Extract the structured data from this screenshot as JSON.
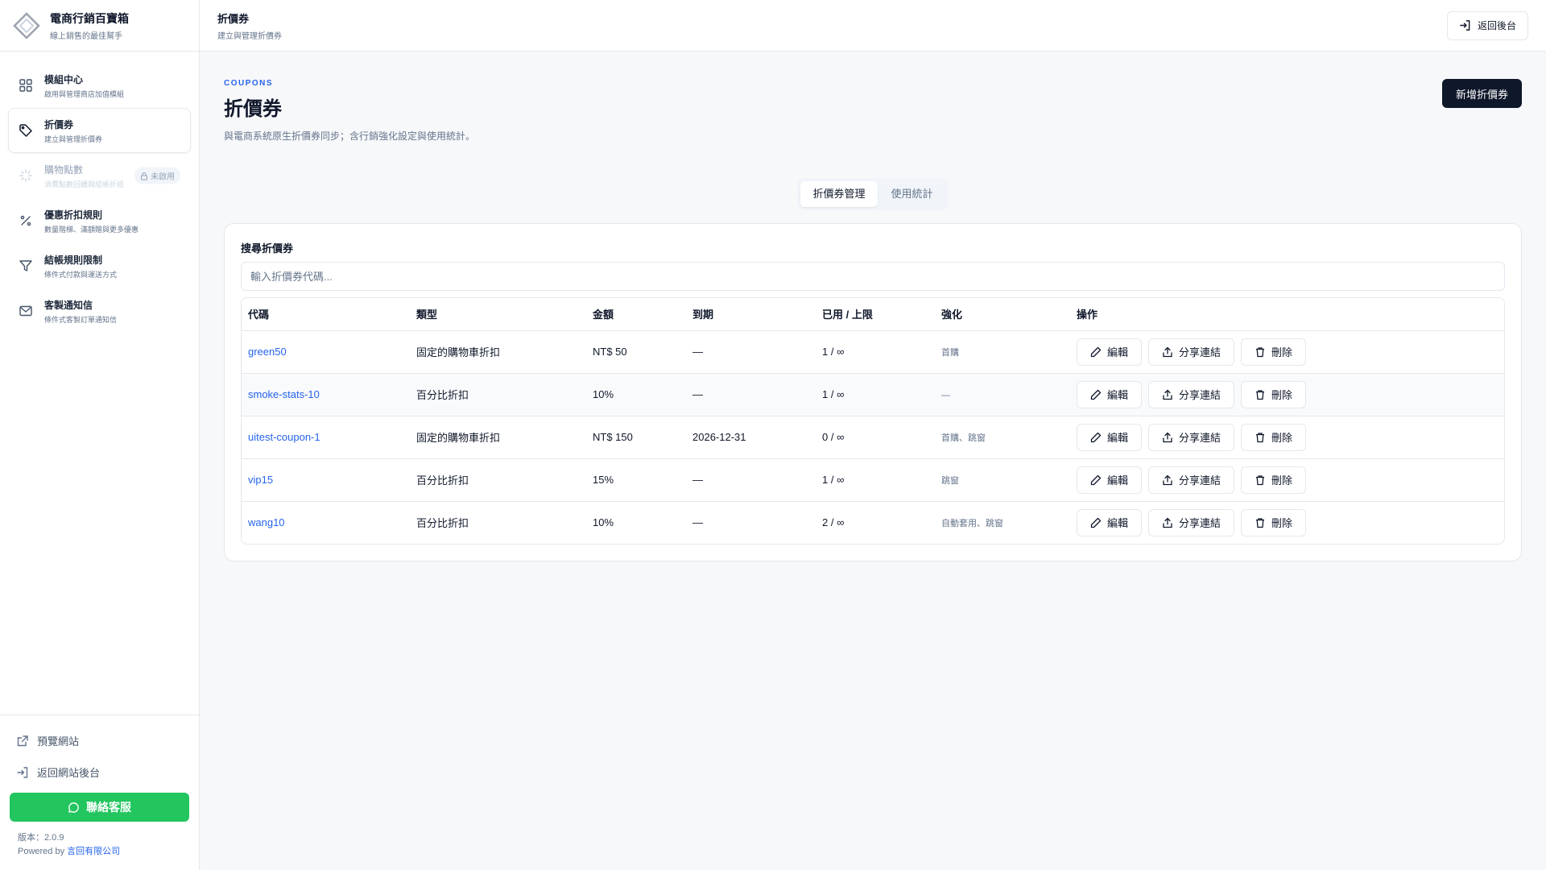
{
  "brand": {
    "title": "電商行銷百寶箱",
    "subtitle": "線上銷售的最佳幫手"
  },
  "sidebar": {
    "items": [
      {
        "label": "模組中心",
        "sub": "啟用與管理商店加值模組"
      },
      {
        "label": "折價券",
        "sub": "建立與管理折價券"
      },
      {
        "label": "購物點數",
        "sub": "消費點數回饋與結帳折抵",
        "badge": "未啟用"
      },
      {
        "label": "優惠折扣規則",
        "sub": "數量階梯、滿額贈與更多優惠"
      },
      {
        "label": "結帳規則限制",
        "sub": "條件式付款與運送方式"
      },
      {
        "label": "客製通知信",
        "sub": "條件式客製訂單通知信"
      }
    ],
    "preview_site": "預覽網站",
    "back_to_admin": "返回網站後台",
    "contact": "聯絡客服",
    "version": "版本：2.0.9",
    "powered_by": "Powered by ",
    "company": "言回有限公司"
  },
  "topbar": {
    "title": "折價券",
    "subtitle": "建立與管理折價券",
    "back_label": "返回後台"
  },
  "page": {
    "eyebrow": "COUPONS",
    "title": "折價券",
    "description": "與電商系統原生折價券同步；含行銷強化設定與使用統計。",
    "new_button": "新增折價券"
  },
  "tabs": [
    "折價券管理",
    "使用統計"
  ],
  "search": {
    "label": "搜尋折價券",
    "placeholder": "輸入折價券代碼..."
  },
  "table": {
    "headers": [
      "代碼",
      "類型",
      "金額",
      "到期",
      "已用 / 上限",
      "強化",
      "操作"
    ],
    "rows": [
      {
        "code": "green50",
        "type": "固定的購物車折扣",
        "amount": "NT$ 50",
        "expiry": "—",
        "usage": "1 / ∞",
        "enhance": "首購"
      },
      {
        "code": "smoke-stats-10",
        "type": "百分比折扣",
        "amount": "10%",
        "expiry": "—",
        "usage": "1 / ∞",
        "enhance": "—"
      },
      {
        "code": "uitest-coupon-1",
        "type": "固定的購物車折扣",
        "amount": "NT$ 150",
        "expiry": "2026-12-31",
        "usage": "0 / ∞",
        "enhance": "首購、跳窗"
      },
      {
        "code": "vip15",
        "type": "百分比折扣",
        "amount": "15%",
        "expiry": "—",
        "usage": "1 / ∞",
        "enhance": "跳窗"
      },
      {
        "code": "wang10",
        "type": "百分比折扣",
        "amount": "10%",
        "expiry": "—",
        "usage": "2 / ∞",
        "enhance": "自動套用、跳窗"
      }
    ],
    "actions": {
      "edit": "編輯",
      "share": "分享連結",
      "delete": "刪除"
    }
  },
  "colors": {
    "accent": "#2563eb",
    "primary": "#0f172a",
    "contact": "#22c55e"
  }
}
